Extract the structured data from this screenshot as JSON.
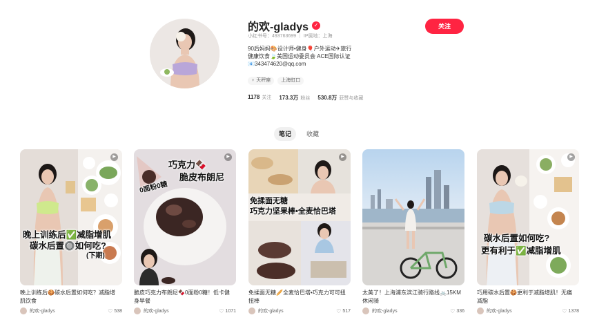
{
  "profile": {
    "name": "的欢-gladys",
    "meta": "小红书号：493763699 ｜ IP属地：上海",
    "follow_label": "关注",
    "bio": [
      "90后妈妈🎨设计师•健身🎈户外运动✈旅行",
      "健康饮食🍃美国运动委员会 ACE国际认证",
      "📧343474620@qq.com"
    ],
    "tags": [
      "♀ 天秤座",
      "上海虹口"
    ],
    "stats": [
      {
        "num": "1178",
        "label": "关注"
      },
      {
        "num": "173.3万",
        "label": "粉丝"
      },
      {
        "num": "530.8万",
        "label": "获赞与收藏"
      }
    ]
  },
  "tabs": [
    {
      "label": "笔记",
      "active": true
    },
    {
      "label": "收藏",
      "active": false
    }
  ],
  "notes": [
    {
      "title": "晚上训练后🍪碳水后置如何吃？减脂增肌饮食",
      "author": "的欢-gladys",
      "likes": "538",
      "overlay": [
        "晚上训练后✅减脂增肌",
        "碳水后置🔘如何吃?",
        "(下期)"
      ]
    },
    {
      "title": "脆皮巧克力布朗尼🍫0面粉0糖！低卡健身早餐",
      "author": "的欢-gladys",
      "likes": "1071",
      "overlay": [
        "巧克力🍫",
        "脆皮布朗尼",
        "0面粉0糖"
      ]
    },
    {
      "title": "免揉面无糖🥖全麦恰巴塔•巧克力可可扭扭棒",
      "author": "的欢-gladys",
      "likes": "517",
      "overlay": [
        "免揉面无糖",
        "巧克力坚果棒•全麦恰巴塔"
      ]
    },
    {
      "title": "太美了！上海浦东滨江骑行路线🚲15KM休闲骑",
      "author": "的欢-gladys",
      "likes": "336",
      "overlay": []
    },
    {
      "title": "巧用碳水后置🍪更利于减脂增肌！无痛减脂",
      "author": "的欢-gladys",
      "likes": "1378",
      "overlay": [
        "碳水后置如何吃?",
        "更有利于✅减脂增肌"
      ]
    }
  ],
  "colors": {
    "accent": "#ff2442"
  }
}
